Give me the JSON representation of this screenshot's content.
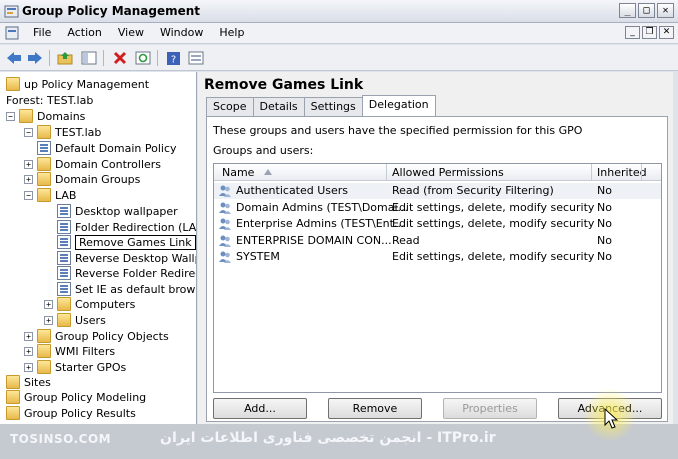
{
  "window": {
    "title": "Group Policy Management"
  },
  "menu": [
    "File",
    "Action",
    "View",
    "Window",
    "Help"
  ],
  "tree": {
    "items": [
      {
        "label": "up Policy Management",
        "level": 0,
        "expander": "",
        "icon": "gpm-icon"
      },
      {
        "label": "Forest: TEST.lab",
        "level": 0,
        "expander": "",
        "icon": ""
      },
      {
        "label": "Domains",
        "level": 0,
        "expander": "−",
        "icon": "domains-icon"
      },
      {
        "label": "TEST.lab",
        "level": 1,
        "expander": "−",
        "icon": "domain-icon"
      },
      {
        "label": "Default Domain Policy",
        "level": 2,
        "expander": "",
        "icon": "gpo-link-icon"
      },
      {
        "label": "Domain Controllers",
        "level": 2,
        "expander": "+",
        "icon": "ou-folder-icon"
      },
      {
        "label": "Domain Groups",
        "level": 2,
        "expander": "+",
        "icon": "ou-folder-icon"
      },
      {
        "label": "LAB",
        "level": 2,
        "expander": "−",
        "icon": "ou-folder-icon"
      },
      {
        "label": "Desktop wallpaper",
        "level": 3,
        "expander": "",
        "icon": "gpo-link-icon"
      },
      {
        "label": "Folder Redirection (LAB)",
        "level": 3,
        "expander": "",
        "icon": "gpo-link-icon"
      },
      {
        "label": "Remove Games Link",
        "level": 3,
        "expander": "",
        "icon": "gpo-link-icon"
      },
      {
        "label": "Reverse Desktop Wallpa",
        "level": 3,
        "expander": "",
        "icon": "gpo-link-icon"
      },
      {
        "label": "Reverse Folder Redirect",
        "level": 3,
        "expander": "",
        "icon": "gpo-link-icon"
      },
      {
        "label": "Set IE as default browse",
        "level": 3,
        "expander": "",
        "icon": "gpo-link-icon"
      },
      {
        "label": "Computers",
        "level": 3,
        "expander": "+",
        "icon": "ou-folder-icon"
      },
      {
        "label": "Users",
        "level": 3,
        "expander": "+",
        "icon": "ou-folder-icon"
      },
      {
        "label": "Group Policy Objects",
        "level": 1,
        "expander": "+",
        "icon": "folder-icon"
      },
      {
        "label": "WMI Filters",
        "level": 1,
        "expander": "+",
        "icon": "folder-icon"
      },
      {
        "label": "Starter GPOs",
        "level": 1,
        "expander": "+",
        "icon": "folder-icon"
      },
      {
        "label": "Sites",
        "level": 0,
        "expander": "",
        "icon": "sites-icon"
      },
      {
        "label": "Group Policy Modeling",
        "level": 0,
        "expander": "",
        "icon": "modeling-icon"
      },
      {
        "label": "Group Policy Results",
        "level": 0,
        "expander": "",
        "icon": "results-icon"
      }
    ]
  },
  "details": {
    "title": "Remove Games Link",
    "tabs": [
      "Scope",
      "Details",
      "Settings",
      "Delegation"
    ],
    "active_tab": "Delegation",
    "description": "These groups and users have the specified permission for this GPO",
    "groups_label": "Groups and users:",
    "columns": [
      "Name",
      "Allowed Permissions",
      "Inherited"
    ],
    "rows": [
      {
        "name": "Authenticated Users",
        "permission": "Read (from Security Filtering)",
        "inherited": "No"
      },
      {
        "name": "Domain Admins (TEST\\Domai...",
        "permission": "Edit settings, delete, modify security",
        "inherited": "No"
      },
      {
        "name": "Enterprise Admins (TEST\\Ent...",
        "permission": "Edit settings, delete, modify security",
        "inherited": "No"
      },
      {
        "name": "ENTERPRISE DOMAIN CON...",
        "permission": "Read",
        "inherited": "No"
      },
      {
        "name": "SYSTEM",
        "permission": "Edit settings, delete, modify security",
        "inherited": "No"
      }
    ],
    "buttons": {
      "add": "Add...",
      "remove": "Remove",
      "properties": "Properties",
      "advanced": "Advanced..."
    }
  },
  "watermark": {
    "left": "TOSINSO.COM",
    "right": "ITPro.ir - انجمن تخصصی فناوری اطلاعات ایران"
  }
}
